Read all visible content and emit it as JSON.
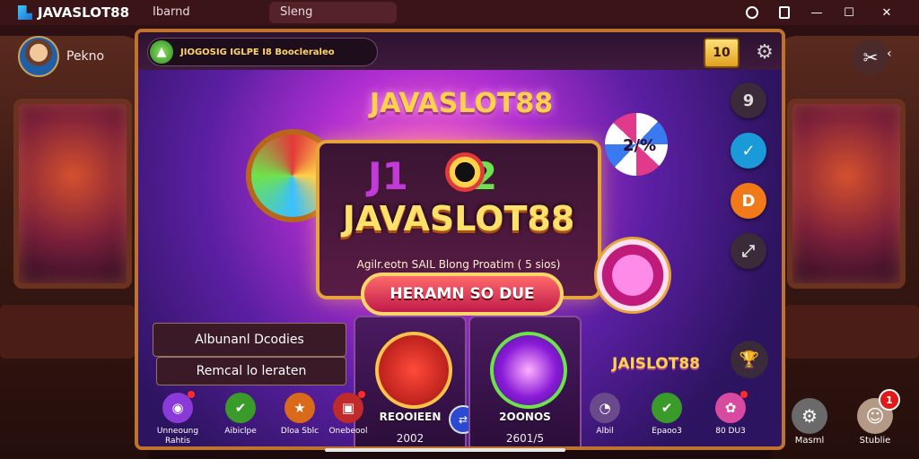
{
  "app": {
    "brand": "JAVASLOT88"
  },
  "tabs": [
    {
      "label": "Ibarnd"
    },
    {
      "label": "Sleng"
    }
  ],
  "player": {
    "name": "Pekno"
  },
  "promo": {
    "text": "JIOGOSIG IGLPE I8 Boocleraleo"
  },
  "header": {
    "coin_label": "10"
  },
  "hero": {
    "logo_top": "JAVASLOT88",
    "line1_left": "J1",
    "line1_right": "2",
    "title": "JAVASLOT88",
    "subtitle": "Agilr.eotn SAIL Blong Proatim ( 5 sios)",
    "cta_label": "HERAMN SO DUE"
  },
  "side_buttons": [
    "9",
    "✓",
    "D",
    "⤢"
  ],
  "chip_label": "2/%",
  "info": {
    "line1": "Albunanl Dcodies",
    "line2": "Remcal lo leraten"
  },
  "tiles": [
    {
      "name": "REOOIEEN",
      "number": "2002"
    },
    {
      "name": "2OONOS",
      "number": "2601/5"
    }
  ],
  "logo_small": "JAISLOT88",
  "bottom_items": [
    {
      "label": "Unneoung Rahtis",
      "icon": "mask-icon",
      "color": "#8a3ad8",
      "dot": true
    },
    {
      "label": "Aibiclpe",
      "icon": "check-icon",
      "color": "#3a9a2a",
      "dot": false
    },
    {
      "label": "Dloa Sblc",
      "icon": "star-icon",
      "color": "#d86a1a",
      "dot": false
    },
    {
      "label": "Onebeool",
      "icon": "gift-icon",
      "color": "#c02a2a",
      "dot": true
    },
    {
      "label": "Albil",
      "icon": "chat-icon",
      "color": "#6a4a8a",
      "dot": false
    },
    {
      "label": "Epaoo3",
      "icon": "check-icon",
      "color": "#3a9a2a",
      "dot": false
    },
    {
      "label": "80 DU3",
      "icon": "candy-icon",
      "color": "#d84aa0",
      "dot": true
    }
  ],
  "right_buttons": [
    {
      "label": "Masml",
      "icon": "gear-icon"
    },
    {
      "label": "Stublie",
      "icon": "profile-icon",
      "badge": "1"
    }
  ]
}
